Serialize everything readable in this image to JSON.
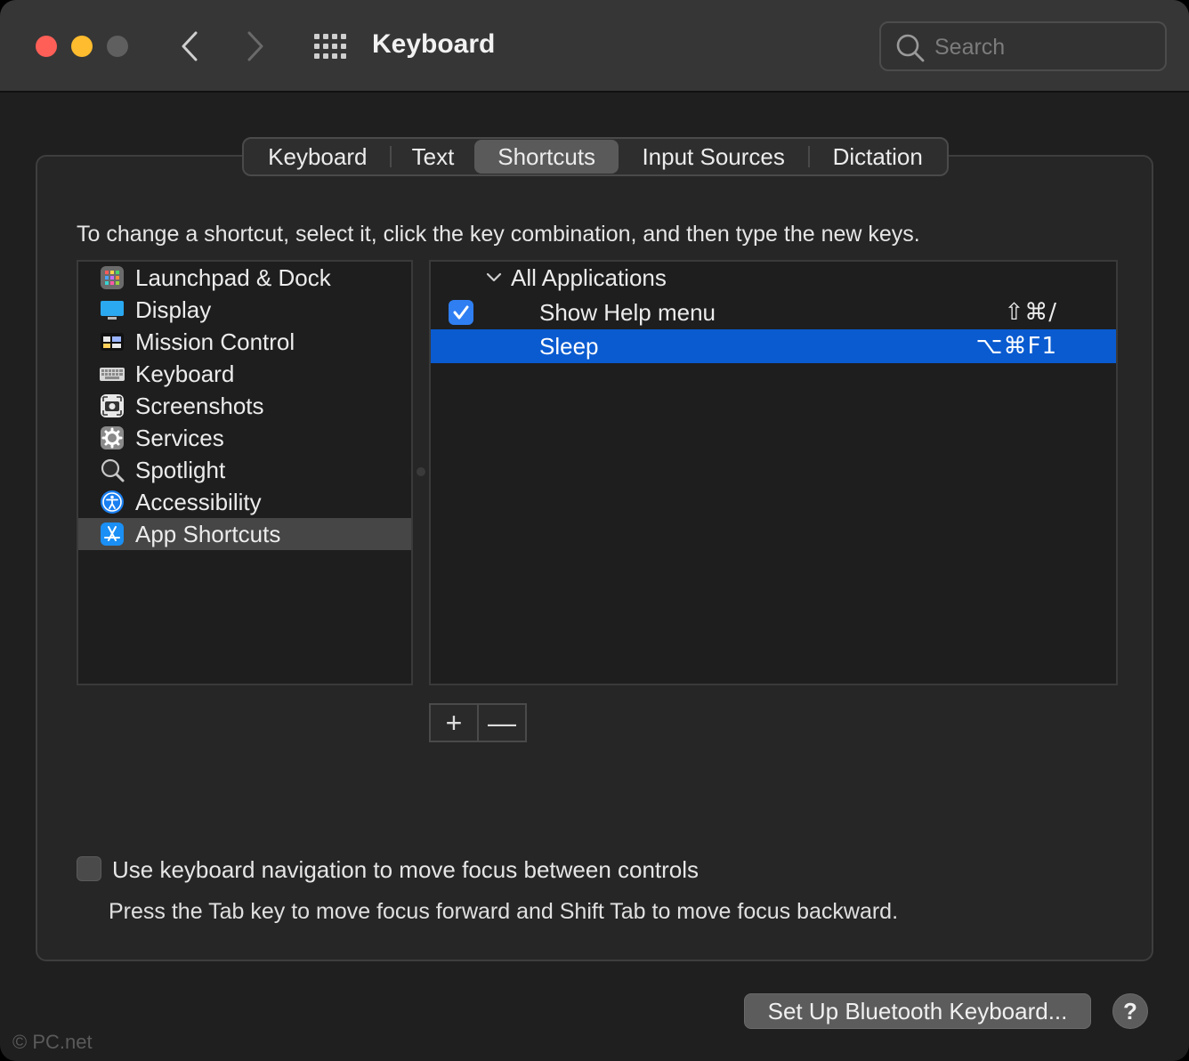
{
  "window": {
    "title": "Keyboard",
    "search_placeholder": "Search",
    "traffic_lights": {
      "close": "#ff5f57",
      "minimize": "#febc2e",
      "zoom": "#5f5f5f"
    }
  },
  "tabs": [
    {
      "label": "Keyboard",
      "active": false
    },
    {
      "label": "Text",
      "active": false
    },
    {
      "label": "Shortcuts",
      "active": true
    },
    {
      "label": "Input Sources",
      "active": false
    },
    {
      "label": "Dictation",
      "active": false
    }
  ],
  "instructions": "To change a shortcut, select it, click the key combination, and then type the new keys.",
  "categories": [
    {
      "label": "Launchpad & Dock",
      "icon": "launchpad-icon"
    },
    {
      "label": "Display",
      "icon": "display-icon"
    },
    {
      "label": "Mission Control",
      "icon": "mission-control-icon"
    },
    {
      "label": "Keyboard",
      "icon": "keyboard-icon"
    },
    {
      "label": "Screenshots",
      "icon": "screenshot-icon"
    },
    {
      "label": "Services",
      "icon": "gear-icon"
    },
    {
      "label": "Spotlight",
      "icon": "magnifier-icon"
    },
    {
      "label": "Accessibility",
      "icon": "accessibility-icon"
    },
    {
      "label": "App Shortcuts",
      "icon": "app-store-icon",
      "selected": true
    }
  ],
  "shortcuts": {
    "group_label": "All Applications",
    "rows": [
      {
        "label": "Show Help menu",
        "keys": "⇧⌘/",
        "checked": true,
        "selected": false
      },
      {
        "label": "Sleep",
        "keys": "⌥⌘F1",
        "checked": false,
        "selected": true
      }
    ]
  },
  "buttons": {
    "add": "+",
    "remove": "—"
  },
  "keyboard_navigation": {
    "label": "Use keyboard navigation to move focus between controls",
    "hint": "Press the Tab key to move focus forward and Shift Tab to move focus backward.",
    "checked": false
  },
  "footer": {
    "bluetooth_button": "Set Up Bluetooth Keyboard...",
    "help_button": "?",
    "watermark": "© PC.net"
  },
  "colors": {
    "selection": "#0a5bd0",
    "checkbox_blue": "#2f7ff3"
  }
}
